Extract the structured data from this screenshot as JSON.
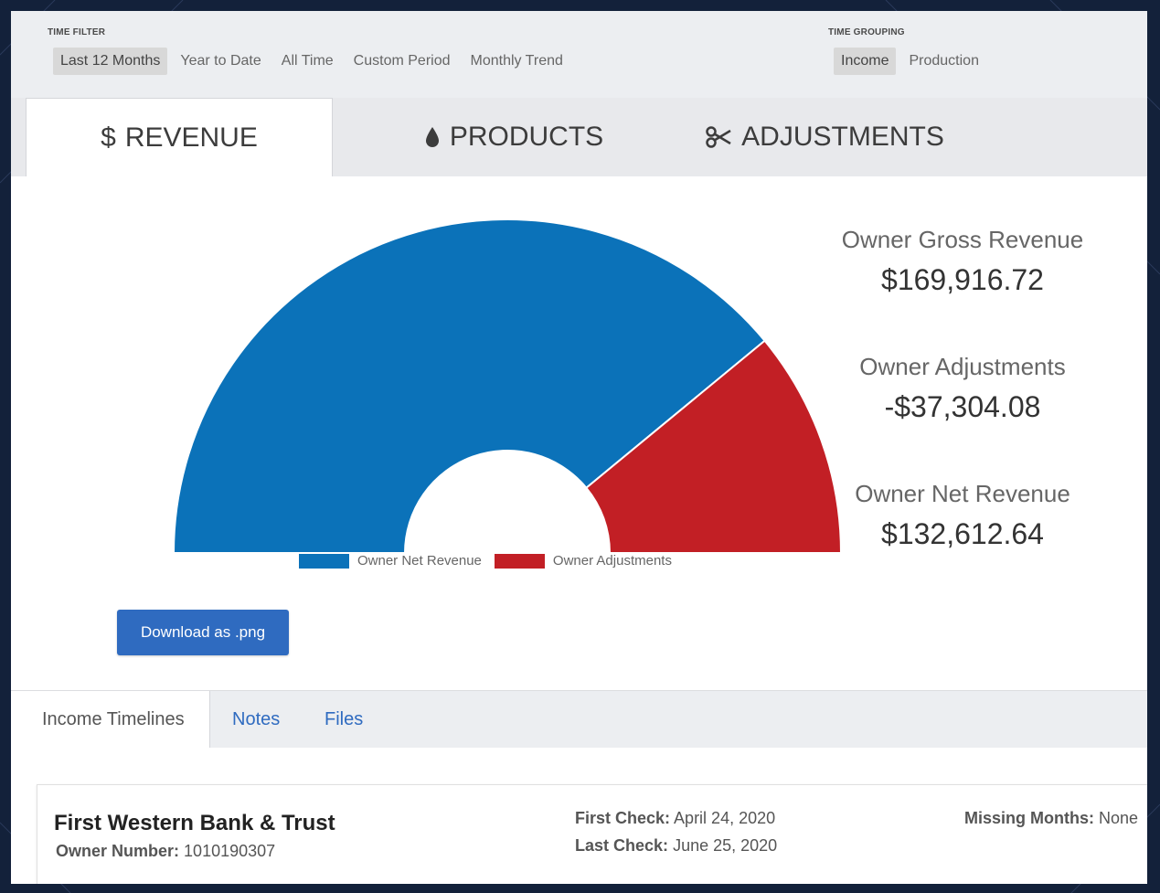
{
  "filters": {
    "time_filter_label": "TIME FILTER",
    "time_filter_options": [
      "Last 12 Months",
      "Year to Date",
      "All Time",
      "Custom Period",
      "Monthly Trend"
    ],
    "time_filter_active": "Last 12 Months",
    "time_grouping_label": "TIME GROUPING",
    "time_grouping_options": [
      "Income",
      "Production"
    ],
    "time_grouping_active": "Income"
  },
  "main_tabs": [
    {
      "label": "REVENUE",
      "icon": "dollar-icon",
      "active": true
    },
    {
      "label": "PRODUCTS",
      "icon": "droplet-icon",
      "active": false
    },
    {
      "label": "ADJUSTMENTS",
      "icon": "scissors-icon",
      "active": false
    }
  ],
  "chart_data": {
    "type": "pie",
    "subtype": "half-donut",
    "categories": [
      "Owner Net Revenue",
      "Owner Adjustments"
    ],
    "values": [
      132612.64,
      37304.08
    ],
    "colors": [
      "#0b72b9",
      "#c21f25"
    ],
    "legend": [
      "Owner Net Revenue",
      "Owner Adjustments"
    ],
    "legend_position": "bottom"
  },
  "stats": [
    {
      "label": "Owner Gross Revenue",
      "value": "$169,916.72"
    },
    {
      "label": "Owner Adjustments",
      "value": "-$37,304.08"
    },
    {
      "label": "Owner Net Revenue",
      "value": "$132,612.64"
    }
  ],
  "download_label": "Download as .png",
  "sub_tabs": [
    {
      "label": "Income Timelines",
      "active": true
    },
    {
      "label": "Notes",
      "active": false
    },
    {
      "label": "Files",
      "active": false
    }
  ],
  "record": {
    "bank_name": "First Western Bank & Trust",
    "owner_number_label": "Owner Number:",
    "owner_number": "1010190307",
    "first_check_label": "First Check:",
    "first_check": "April 24, 2020",
    "last_check_label": "Last Check:",
    "last_check": "June 25, 2020",
    "missing_months_label": "Missing Months:",
    "missing_months": "None"
  },
  "colors": {
    "accent": "#2f6bc0",
    "net_revenue": "#0b72b9",
    "adjustments": "#c21f25",
    "frame_bg": "#13213a"
  }
}
